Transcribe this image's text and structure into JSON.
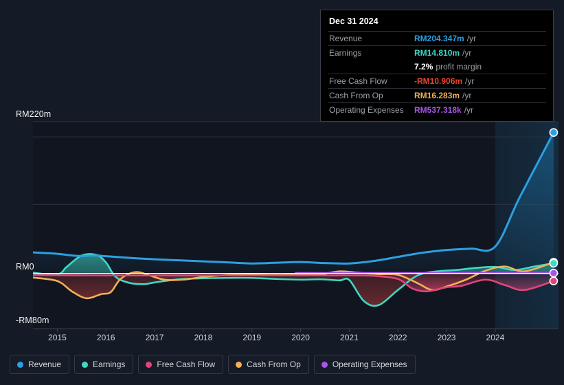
{
  "chart_data": {
    "type": "area",
    "title": "",
    "currency_prefix": "RM",
    "xlabel": "",
    "ylabel": "",
    "x_tick_labels": [
      "2015",
      "2016",
      "2017",
      "2018",
      "2019",
      "2020",
      "2021",
      "2022",
      "2023",
      "2024"
    ],
    "y_tick_labels": [
      "RM220m",
      "RM0",
      "-RM80m"
    ],
    "ylim": [
      -80,
      220
    ],
    "xlim": [
      2014.5,
      2025.3
    ],
    "grid": true,
    "legend_position": "bottom",
    "forecast_start_x": 2024.0,
    "series": [
      {
        "name": "Revenue",
        "color": "#2c9fe2",
        "x": [
          2014.5,
          2015.0,
          2015.4,
          2015.8,
          2016.0,
          2016.5,
          2017.0,
          2017.5,
          2018.0,
          2018.5,
          2019.0,
          2019.5,
          2020.0,
          2020.5,
          2021.0,
          2021.5,
          2022.0,
          2022.5,
          2023.0,
          2023.5,
          2024.0,
          2024.5,
          2025.2
        ],
        "values": [
          30.5,
          28.5,
          25.5,
          26.0,
          25.0,
          22.5,
          20.5,
          19.0,
          17.5,
          16.0,
          14.5,
          15.5,
          16.5,
          15.0,
          14.5,
          18.0,
          24.0,
          30.0,
          34.0,
          36.0,
          39.0,
          110.0,
          204.347
        ],
        "end_value": 204.347
      },
      {
        "name": "Earnings",
        "color": "#3fd9c5",
        "x": [
          2014.5,
          2015.0,
          2015.2,
          2015.5,
          2015.8,
          2016.0,
          2016.2,
          2016.5,
          2016.8,
          2017.0,
          2017.5,
          2018.0,
          2018.5,
          2019.0,
          2019.5,
          2020.0,
          2020.4,
          2020.8,
          2021.0,
          2021.3,
          2021.6,
          2022.0,
          2022.4,
          2022.8,
          2023.2,
          2023.6,
          2024.0,
          2024.4,
          2024.8,
          2025.2
        ],
        "values": [
          1.0,
          -1.5,
          10.0,
          26.0,
          27.0,
          16.0,
          -5.0,
          -14.0,
          -15.5,
          -13.0,
          -8.5,
          -7.0,
          -6.5,
          -6.5,
          -8.0,
          -9.0,
          -8.5,
          -10.0,
          -9.5,
          -40.0,
          -46.0,
          -24.0,
          -3.0,
          3.0,
          5.0,
          8.0,
          9.5,
          5.0,
          10.0,
          14.81
        ],
        "end_value": 14.81
      },
      {
        "name": "Free Cash Flow",
        "color": "#e0457b",
        "x": [
          2014.5,
          2016.0,
          2017.0,
          2018.0,
          2019.0,
          2019.8,
          2020.5,
          2021.0,
          2021.5,
          2022.0,
          2022.3,
          2022.6,
          2023.0,
          2023.3,
          2023.8,
          2024.2,
          2024.6,
          2025.2
        ],
        "values": [
          -2.5,
          -3.0,
          -3.0,
          -3.0,
          -3.0,
          -3.0,
          -3.0,
          -3.0,
          -3.5,
          -8.0,
          -22.0,
          -26.0,
          -20.0,
          -18.0,
          -9.0,
          -17.0,
          -24.0,
          -10.906
        ],
        "end_value": -10.906
      },
      {
        "name": "Cash From Op",
        "color": "#f0b155",
        "x": [
          2014.5,
          2015.0,
          2015.3,
          2015.6,
          2015.9,
          2016.1,
          2016.3,
          2016.6,
          2016.9,
          2017.2,
          2017.6,
          2018.0,
          2018.5,
          2019.0,
          2019.5,
          2020.0,
          2020.4,
          2020.8,
          2021.2,
          2021.6,
          2022.0,
          2022.4,
          2022.7,
          2023.0,
          2023.4,
          2023.8,
          2024.2,
          2024.6,
          2025.2
        ],
        "values": [
          -6.0,
          -11.0,
          -26.0,
          -36.0,
          -30.0,
          -27.0,
          -8.0,
          2.0,
          -3.0,
          -9.0,
          -9.0,
          -5.0,
          -2.5,
          -2.0,
          -2.5,
          -2.0,
          -1.5,
          3.0,
          1.0,
          -1.0,
          -2.0,
          -14.0,
          -24.0,
          -19.0,
          -9.0,
          4.0,
          10.0,
          3.0,
          16.283
        ],
        "end_value": 16.283
      },
      {
        "name": "Operating Expenses",
        "color": "#a855e8",
        "x": [
          2019.9,
          2020.5,
          2021.0,
          2021.5,
          2022.0,
          2022.5,
          2023.0,
          2023.5,
          2024.0,
          2024.5,
          2025.2
        ],
        "values": [
          0.537,
          0.537,
          0.537,
          0.537,
          0.537,
          0.537,
          0.537,
          0.537,
          0.537,
          0.537,
          0.537
        ],
        "end_value": 0.537318
      }
    ]
  },
  "tooltip": {
    "title": "Dec 31 2024",
    "rows": [
      {
        "label": "Revenue",
        "value": "RM204.347m",
        "suffix": "/yr",
        "color": "#2c9fe2"
      },
      {
        "label": "Earnings",
        "value": "RM14.810m",
        "suffix": "/yr",
        "color": "#3fd9c5"
      },
      {
        "label": "",
        "value": "7.2%",
        "suffix": "profit margin",
        "color": "#ffffff"
      },
      {
        "label": "Free Cash Flow",
        "value": "-RM10.906m",
        "suffix": "/yr",
        "color": "#e8442e"
      },
      {
        "label": "Cash From Op",
        "value": "RM16.283m",
        "suffix": "/yr",
        "color": "#f0b155"
      },
      {
        "label": "Operating Expenses",
        "value": "RM537.318k",
        "suffix": "/yr",
        "color": "#a855e8"
      }
    ]
  },
  "legend": {
    "items": [
      {
        "label": "Revenue",
        "color": "#2c9fe2"
      },
      {
        "label": "Earnings",
        "color": "#3fd9c5"
      },
      {
        "label": "Free Cash Flow",
        "color": "#e0457b"
      },
      {
        "label": "Cash From Op",
        "color": "#f0b155"
      },
      {
        "label": "Operating Expenses",
        "color": "#a855e8"
      }
    ]
  },
  "axis": {
    "y_top": "RM220m",
    "y_zero": "RM0",
    "y_bottom": "-RM80m"
  }
}
